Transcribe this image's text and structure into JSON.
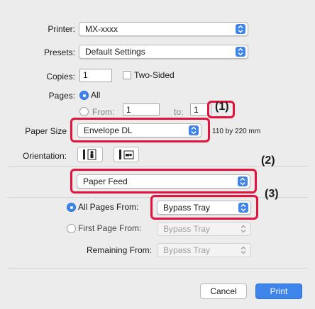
{
  "printer": {
    "label": "Printer:",
    "value": "MX-xxxx"
  },
  "presets": {
    "label": "Presets:",
    "value": "Default Settings"
  },
  "copies": {
    "label": "Copies:",
    "value": "1",
    "two_sided_label": "Two-Sided"
  },
  "pages": {
    "label": "Pages:",
    "all_label": "All",
    "from_label": "From:",
    "from_value": "1",
    "to_label": "to:",
    "to_value": "1"
  },
  "paper_size": {
    "label": "Paper Size",
    "value": "Envelope DL",
    "dimensions": "110 by 220 mm"
  },
  "orientation": {
    "label": "Orientation:"
  },
  "section": {
    "value": "Paper Feed"
  },
  "feed": {
    "all_pages_label": "All Pages From:",
    "all_pages_value": "Bypass Tray",
    "first_page_label": "First Page From:",
    "first_page_value": "Bypass Tray",
    "remaining_label": "Remaining From:",
    "remaining_value": "Bypass Tray"
  },
  "callouts": {
    "c1": "(1)",
    "c2": "(2)",
    "c3": "(3)"
  },
  "buttons": {
    "cancel": "Cancel",
    "print": "Print"
  },
  "colors": {
    "accent": "#3f84e8",
    "highlight": "#e3133d"
  }
}
